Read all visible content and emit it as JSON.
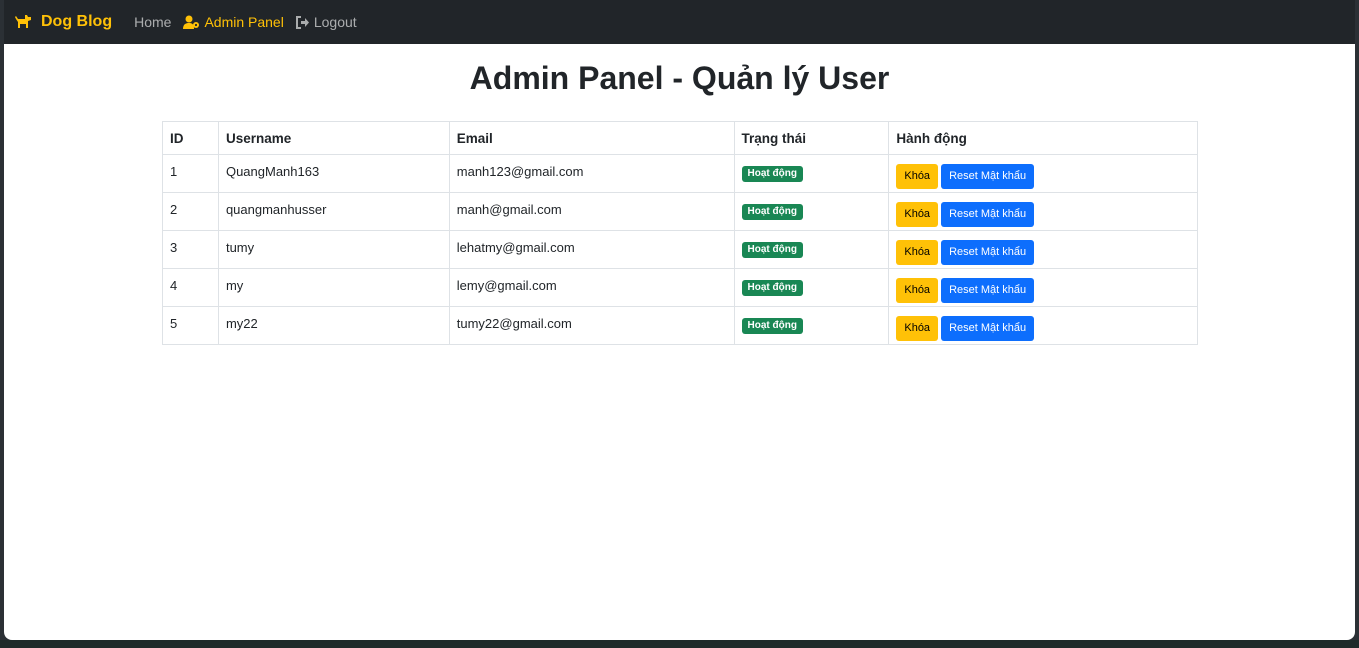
{
  "navbar": {
    "brand": "Dog Blog",
    "brand_icon": "dog-icon",
    "links": [
      {
        "label": "Home",
        "icon": null
      },
      {
        "label": "Admin Panel",
        "icon": "user-gear-icon",
        "active": true
      },
      {
        "label": "Logout",
        "icon": "logout-icon"
      }
    ]
  },
  "page": {
    "title": "Admin Panel - Quản lý User"
  },
  "table": {
    "headers": [
      "ID",
      "Username",
      "Email",
      "Trạng thái",
      "Hành động"
    ],
    "rows": [
      {
        "id": "1",
        "username": "QuangManh163",
        "email": "manh123@gmail.com",
        "status": "Hoạt động",
        "lock_label": "Khóa",
        "reset_label": "Reset Mật khẩu"
      },
      {
        "id": "2",
        "username": "quangmanhusser",
        "email": "manh@gmail.com",
        "status": "Hoạt động",
        "lock_label": "Khóa",
        "reset_label": "Reset Mật khẩu"
      },
      {
        "id": "3",
        "username": "tumy",
        "email": "lehatmy@gmail.com",
        "status": "Hoạt động",
        "lock_label": "Khóa",
        "reset_label": "Reset Mật khẩu"
      },
      {
        "id": "4",
        "username": "my",
        "email": "lemy@gmail.com",
        "status": "Hoạt động",
        "lock_label": "Khóa",
        "reset_label": "Reset Mật khẩu"
      },
      {
        "id": "5",
        "username": "my22",
        "email": "tumy22@gmail.com",
        "status": "Hoạt động",
        "lock_label": "Khóa",
        "reset_label": "Reset Mật khẩu"
      }
    ]
  },
  "colors": {
    "navbar_bg": "#212529",
    "accent": "#ffc107",
    "status_active": "#198754",
    "primary": "#0d6efd"
  }
}
